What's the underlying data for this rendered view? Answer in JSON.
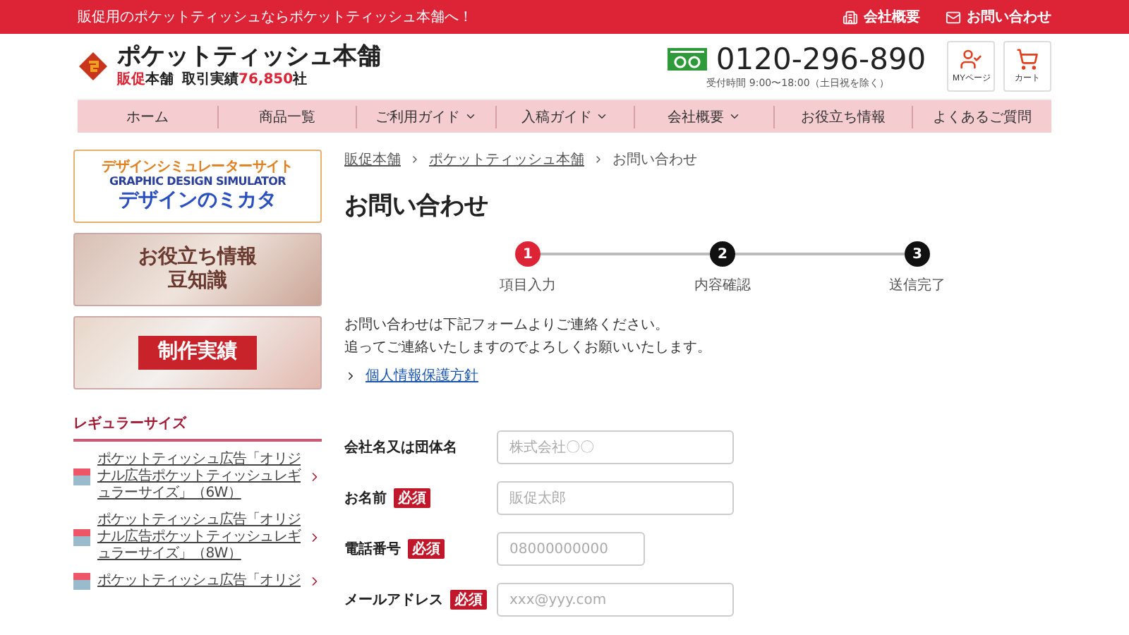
{
  "top_bar": {
    "message": "販促用のポケットティッシュならポケットティッシュ本舗へ！",
    "links": [
      {
        "kind": "company",
        "label": "会社概要"
      },
      {
        "kind": "mail",
        "label": "お問い合わせ"
      }
    ]
  },
  "header": {
    "site_title": "ポケットティッシュ本舗",
    "brand_accent": "販促",
    "brand_rest": "本舗",
    "record_label": "取引実績",
    "record_count": "76,850",
    "record_unit": "社",
    "phone": "0120-296-890",
    "hours": "受付時間 9:00〜18:00（土日祝を除く）",
    "buttons": [
      {
        "kind": "mypage",
        "label": "MYページ"
      },
      {
        "kind": "cart",
        "label": "カート"
      }
    ]
  },
  "nav": [
    {
      "label": "ホーム",
      "has_menu": false
    },
    {
      "label": "商品一覧",
      "has_menu": false
    },
    {
      "label": "ご利用ガイド",
      "has_menu": true
    },
    {
      "label": "入稿ガイド",
      "has_menu": true
    },
    {
      "label": "会社概要",
      "has_menu": true
    },
    {
      "label": "お役立ち情報",
      "has_menu": false
    },
    {
      "label": "よくあるご質問",
      "has_menu": false
    }
  ],
  "sidebar": {
    "banners": [
      {
        "kind": "simulator",
        "lines": [
          "デザインシミュレーターサイト",
          "GRAPHIC DESIGN SIMULATOR",
          "デザインのミカタ"
        ]
      },
      {
        "kind": "tips",
        "lines": [
          "お役立ち情報",
          "豆知識"
        ]
      },
      {
        "kind": "works",
        "lines": [
          "制作実績"
        ]
      }
    ],
    "section_title": "レギュラーサイズ",
    "products": [
      {
        "label": "ポケットティッシュ広告「オリジナル広告ポケットティッシュレギュラーサイズ」（6W）"
      },
      {
        "label": "ポケットティッシュ広告「オリジナル広告ポケットティッシュレギュラーサイズ」（8W）"
      },
      {
        "label": "ポケットティッシュ広告「オリジ"
      }
    ]
  },
  "breadcrumb": [
    {
      "label": "販促本舗",
      "link": true
    },
    {
      "label": "ポケットティッシュ本舗",
      "link": true
    },
    {
      "label": "お問い合わせ",
      "link": false
    }
  ],
  "page_title": "お問い合わせ",
  "steps": [
    {
      "number": "1",
      "label": "項目入力",
      "selected": true
    },
    {
      "number": "2",
      "label": "内容確認",
      "selected": false
    },
    {
      "number": "3",
      "label": "送信完了",
      "selected": false
    }
  ],
  "intro": [
    "お問い合わせは下記フォームよりご連絡ください。",
    "追ってご連絡いたしますのでよろしくお願いいたします。"
  ],
  "privacy_link": "個人情報保護方針",
  "form": [
    {
      "label": "会社名又は団体名",
      "required": false,
      "placeholder": "株式会社〇〇",
      "wide": true
    },
    {
      "label": "お名前",
      "required": true,
      "required_label": "必須",
      "placeholder": "販促太郎",
      "wide": true
    },
    {
      "label": "電話番号",
      "required": true,
      "required_label": "必須",
      "placeholder": "08000000000",
      "wide": false
    },
    {
      "label": "メールアドレス",
      "required": true,
      "required_label": "必須",
      "placeholder": "xxx@yyy.com",
      "wide": true
    }
  ]
}
